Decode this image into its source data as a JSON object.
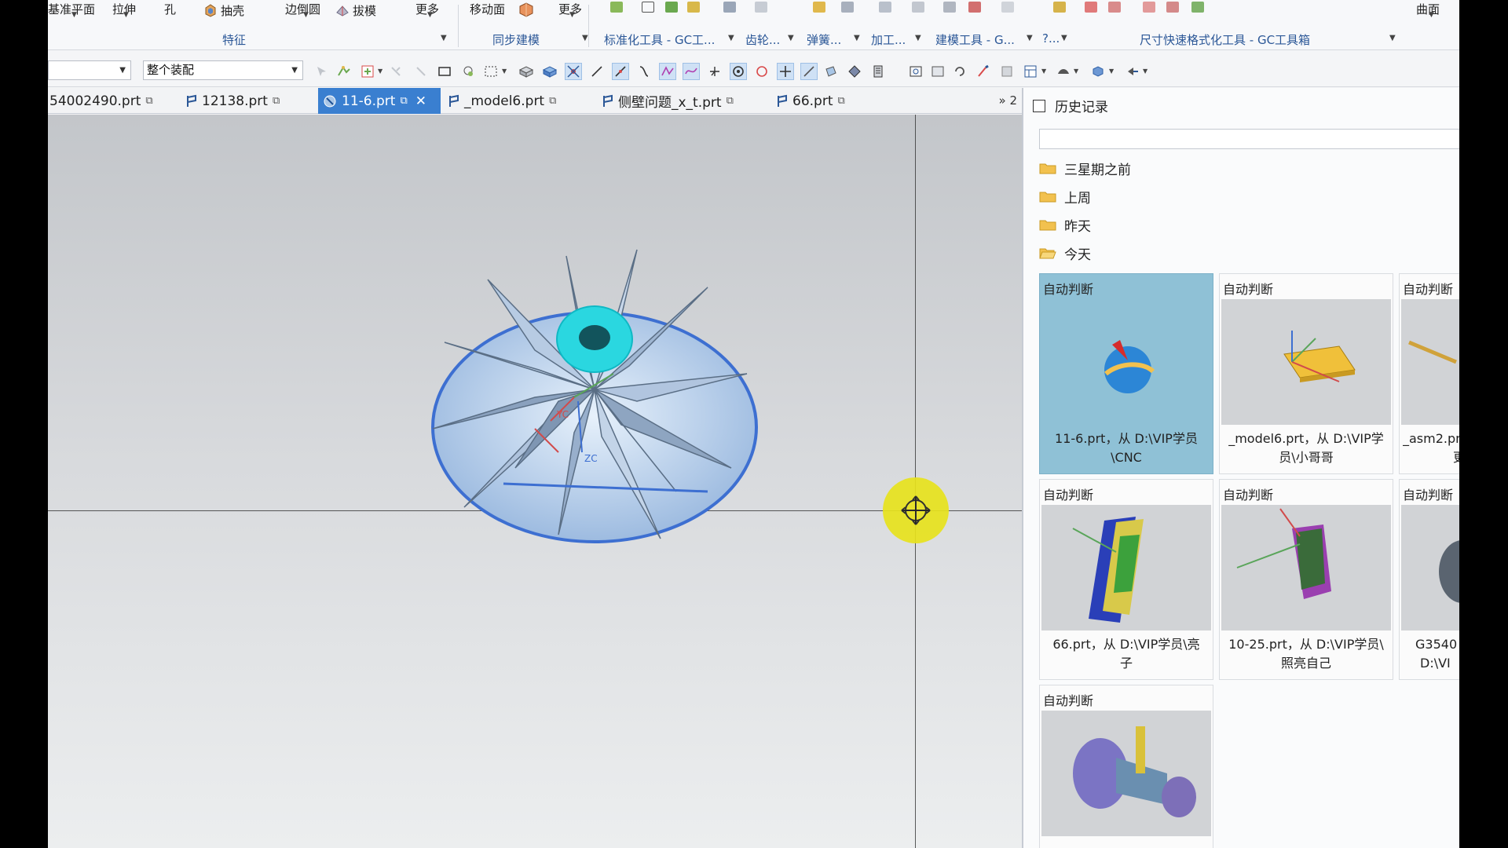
{
  "ribbon": {
    "commands": [
      "基准平面",
      "拉伸",
      "孔",
      "抽壳",
      "边倒圆",
      "拔模",
      "更多",
      "移动面",
      "更多",
      "曲面"
    ],
    "groups": [
      "特征",
      "同步建模",
      "标准化工具 - GC工...",
      "齿轮...",
      "弹簧...",
      "加工...",
      "建模工具 - G...",
      "?...",
      "尺寸快速格式化工具 - GC工具箱"
    ]
  },
  "toolbar": {
    "filter_value": "",
    "assembly_scope": "整个装配"
  },
  "tabs": [
    {
      "label": "54002490.prt",
      "active": false
    },
    {
      "label": "12138.prt",
      "active": false
    },
    {
      "label": "11-6.prt",
      "active": true
    },
    {
      "label": "_model6.prt",
      "active": false
    },
    {
      "label": "侧壁问题_x_t.prt",
      "active": false
    },
    {
      "label": "66.prt",
      "active": false
    }
  ],
  "tab_overflow": "» 2",
  "viewport": {
    "axis_labels": [
      "YC",
      "ZC"
    ]
  },
  "history_panel": {
    "title": "历史记录",
    "search_value": "",
    "groups": [
      "三星期之前",
      "上周",
      "昨天",
      "今天"
    ],
    "cards": [
      {
        "type_label": "自动判断",
        "caption_line1": "11-6.prt，从 D:\\VIP学员",
        "caption_line2": "\\CNC",
        "selected": true
      },
      {
        "type_label": "自动判断",
        "caption_line1": "_model6.prt，从 D:\\VIP学",
        "caption_line2": "员\\小哥哥",
        "selected": false
      },
      {
        "type_label": "自动判断",
        "caption_line1": "_asm2.pr",
        "caption_line2": "更",
        "selected": false
      },
      {
        "type_label": "自动判断",
        "caption_line1": "66.prt，从 D:\\VIP学员\\亮",
        "caption_line2": "子",
        "selected": false
      },
      {
        "type_label": "自动判断",
        "caption_line1": "10-25.prt，从 D:\\VIP学员\\",
        "caption_line2": "照亮自己",
        "selected": false
      },
      {
        "type_label": "自动判断",
        "caption_line1": "G3540",
        "caption_line2": "D:\\VI",
        "selected": false
      },
      {
        "type_label": "自动判断",
        "caption_line1": "",
        "caption_line2": "",
        "selected": false
      }
    ]
  },
  "colors": {
    "accent": "#3a7fd0",
    "selected_card": "#8fc1d6",
    "impeller": "#a9c6e6",
    "hub": "#2ad7e0",
    "cursor_highlight": "#e8e31d"
  }
}
